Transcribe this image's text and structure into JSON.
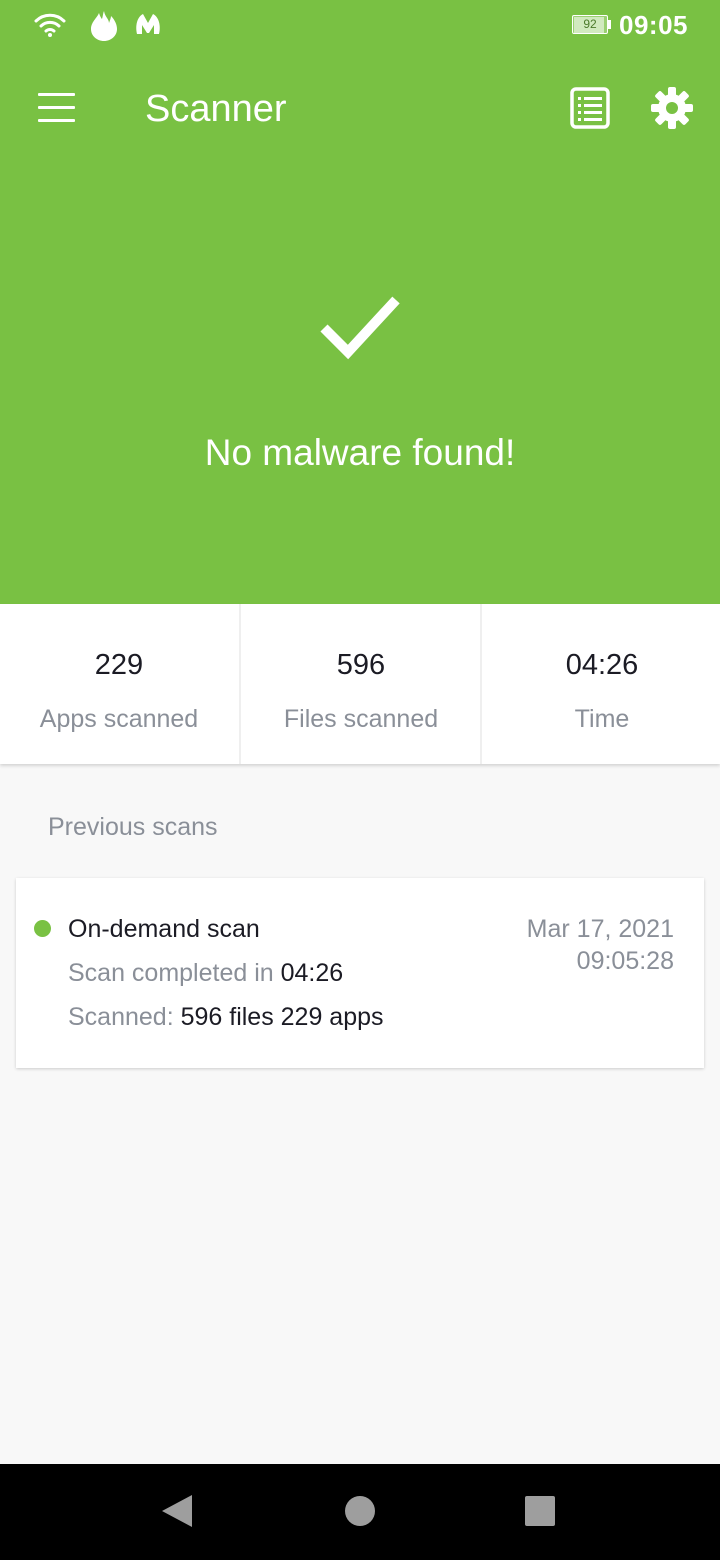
{
  "status_bar": {
    "battery_percent": "92",
    "time": "09:05",
    "icons": [
      "wifi-icon",
      "fire-icon",
      "malwarebytes-icon"
    ]
  },
  "toolbar": {
    "title": "Scanner",
    "menu_icon": "menu-icon",
    "history_icon": "scan-history-icon",
    "settings_icon": "gear-icon"
  },
  "hero": {
    "icon": "checkmark-icon",
    "message": "No malware found!"
  },
  "stats": [
    {
      "value": "229",
      "label": "Apps scanned"
    },
    {
      "value": "596",
      "label": "Files scanned"
    },
    {
      "value": "04:26",
      "label": "Time"
    }
  ],
  "previous_scans": {
    "title": "Previous scans",
    "items": [
      {
        "status_color": "#79c143",
        "type": "On-demand scan",
        "completed_prefix": "Scan completed in ",
        "duration": "04:26",
        "scanned_prefix": "Scanned: ",
        "scanned_summary": "596 files 229 apps",
        "date": "Mar 17, 2021",
        "time": "09:05:28"
      }
    ]
  },
  "nav_bar": {
    "icons": [
      "back-icon",
      "home-icon",
      "recents-icon"
    ]
  },
  "colors": {
    "brand_green": "#79c143",
    "muted_text": "#8a8f98",
    "dark_text": "#1b1b24"
  }
}
